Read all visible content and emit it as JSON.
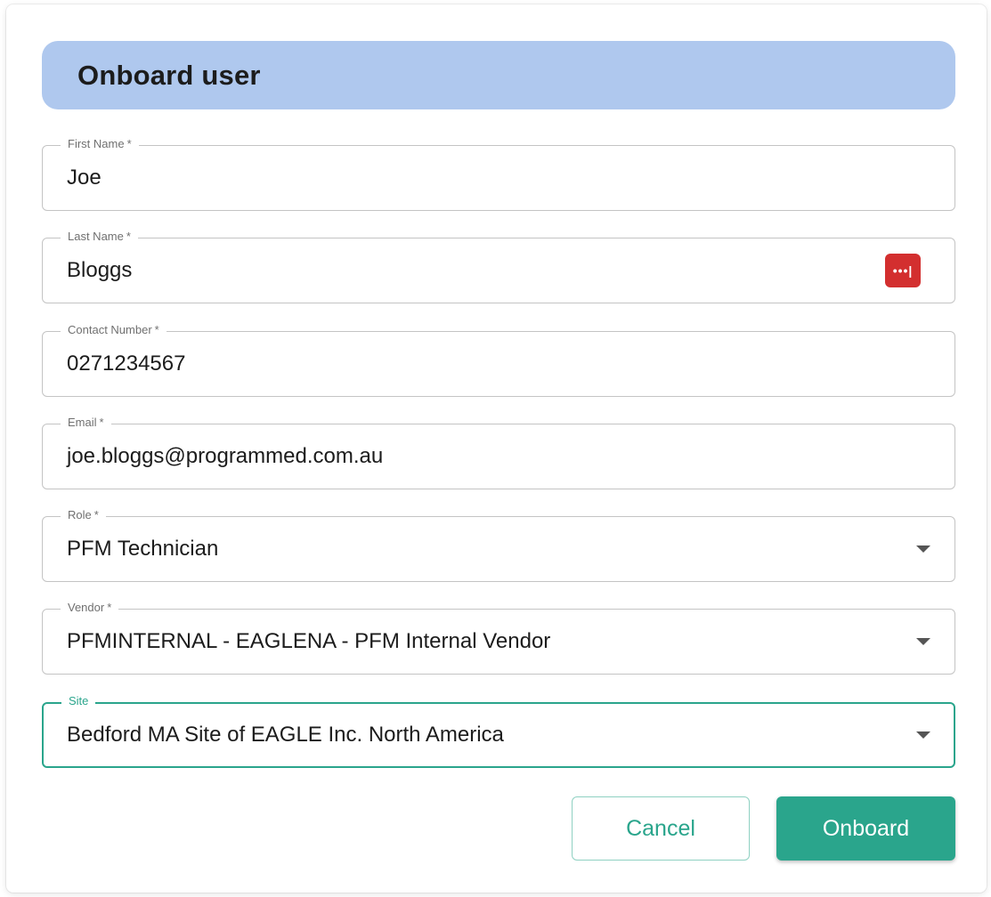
{
  "dialog": {
    "title": "Onboard user"
  },
  "fields": {
    "first_name": {
      "label": "First Name",
      "required": "*",
      "value": "Joe"
    },
    "last_name": {
      "label": "Last Name",
      "required": "*",
      "value": "Bloggs",
      "icon": "password-manager-icon",
      "icon_glyph": "•••|"
    },
    "contact_number": {
      "label": "Contact Number",
      "required": "*",
      "value": "0271234567"
    },
    "email": {
      "label": "Email",
      "required": "*",
      "value": "joe.bloggs@programmed.com.au"
    },
    "role": {
      "label": "Role",
      "required": "*",
      "value": "PFM Technician"
    },
    "vendor": {
      "label": "Vendor",
      "required": "*",
      "value": "PFMINTERNAL - EAGLENA - PFM Internal Vendor"
    },
    "site": {
      "label": "Site",
      "value": "Bedford MA Site of EAGLE Inc. North America"
    }
  },
  "actions": {
    "cancel_label": "Cancel",
    "onboard_label": "Onboard"
  },
  "colors": {
    "header_bg": "#afc8ee",
    "accent": "#2aa58c",
    "password_icon_bg": "#d32f2f"
  }
}
